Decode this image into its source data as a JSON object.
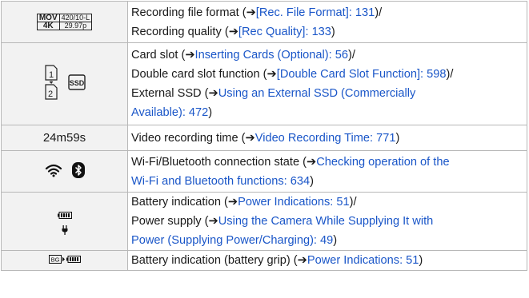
{
  "rows": [
    {
      "icon": {
        "format": "MOV",
        "bitrate": "420/10-L",
        "resolution": "4K",
        "framerate": "29.97p"
      },
      "lines": [
        {
          "text": "Recording file format (",
          "link": "[Rec. File Format]: 131",
          "after": ")/"
        },
        {
          "text": "Recording quality (",
          "link": "[Rec Quality]: 133",
          "after": ")"
        }
      ]
    },
    {
      "icon": {
        "card1": "1",
        "card2": "2",
        "ssd": "SSD"
      },
      "lines": [
        {
          "text": "Card slot (",
          "link": "Inserting Cards (Optional): 56",
          "after": ")/"
        },
        {
          "text": "Double card slot function (",
          "link": "[Double Card Slot Function]: 598",
          "after": ")/"
        },
        {
          "text": "External SSD (",
          "link": "Using an External SSD (Commercially",
          "after": ""
        },
        {
          "text": "",
          "link": "Available): 472",
          "after": ")"
        }
      ]
    },
    {
      "icon": {
        "time": "24m59s"
      },
      "lines": [
        {
          "text": "Video recording time (",
          "link": "Video Recording Time: 771",
          "after": ")"
        }
      ]
    },
    {
      "icon": {
        "wifi": "wifi-icon",
        "bluetooth": "bluetooth-icon"
      },
      "lines": [
        {
          "text": "Wi-Fi/Bluetooth connection state (",
          "link": "Checking operation of the",
          "after": ""
        },
        {
          "text": "",
          "link": "Wi-Fi and Bluetooth functions: 634",
          "after": ")"
        }
      ]
    },
    {
      "icon": {
        "battery": "battery-icon",
        "power": "power-plug-icon"
      },
      "lines": [
        {
          "text": "Battery indication (",
          "link": "Power Indications: 51",
          "after": ")/"
        },
        {
          "text": "Power supply (",
          "link": "Using the Camera While Supplying It with",
          "after": ""
        },
        {
          "text": "",
          "link": "Power (Supplying Power/Charging): 49",
          "after": ")"
        }
      ]
    },
    {
      "icon": {
        "grip": "BG"
      },
      "lines": [
        {
          "text": "Battery indication (battery grip) (",
          "link": "Power Indications: 51",
          "after": ")"
        }
      ]
    }
  ],
  "arrow": "➔",
  "colors": {
    "link": "#1a56c8",
    "icon_bg": "#f2f2f2",
    "border": "#b8b8b8"
  }
}
